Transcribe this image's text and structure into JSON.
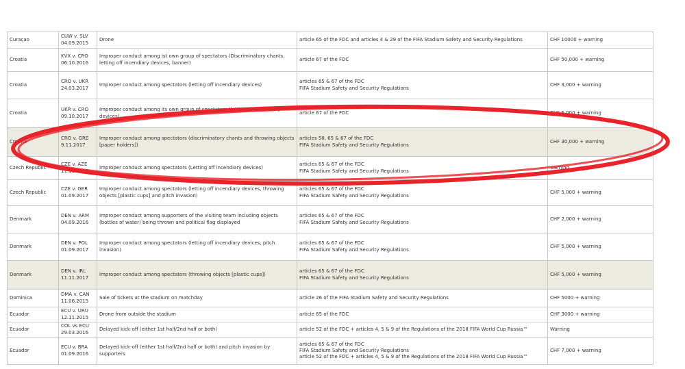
{
  "rows": [
    {
      "country": "Curaçao",
      "match": [
        "CUW v. SLV",
        "04.09.2015"
      ],
      "offence": "Drone",
      "regulations": [
        "article 65 of the FDC and articles 4 & 29 of the FIFA Stadium Safety and Security Regulations"
      ],
      "sanction": "CHF 10000 + warning",
      "height": 24,
      "highlight": false
    },
    {
      "country": "Croatia",
      "match": [
        "KVX v. CRO",
        "06.10.2016"
      ],
      "offence": "Improper conduct among ist own group of spectators (Discriminatory chants, letting off incendiary devices, banner)",
      "regulations": [
        "article 67 of the FDC"
      ],
      "sanction": "CHF 50,000 + warning",
      "height": 34,
      "highlight": false
    },
    {
      "country": "Croatia",
      "match": [
        "CRO v. UKR",
        "24.03.2017"
      ],
      "offence": "Improper conduct among spectators (letting off incendiary devices)",
      "regulations": [
        "articles 65 & 67 of the FDC",
        "FIFA Stadium Safety and Security Regulations"
      ],
      "sanction": "CHF 3,000 + warning",
      "height": 40,
      "highlight": false
    },
    {
      "country": "Croatia",
      "match": [
        "UKR v. CRO",
        "09.10.2017"
      ],
      "offence": "Improper conduct among its own group of spectators (letting off incendiary devices)",
      "regulations": [
        "article 67 of the FDC"
      ],
      "sanction": "CHF 5,000 + warning",
      "height": 42,
      "highlight": false
    },
    {
      "country": "Croatia",
      "match": [
        "CRO v. GRE",
        "9.11.2017"
      ],
      "offence": "Improper conduct among spectators (discriminatory chants and throwing objects [paper holders])",
      "regulations": [
        "articles 58, 65 & 67 of the FDC",
        "FIFA Stadium Safety and Security Regulations"
      ],
      "sanction": "CHF 30,000 + warning",
      "height": 42,
      "highlight": true
    },
    {
      "country": "Czech Republic",
      "match": [
        "CZE v. AZE",
        "11.11.2017"
      ],
      "offence": "Improper conduct among spectators (Letting off incendiary devices)",
      "regulations": [
        "articles 65 & 67 of the FDC",
        "FIFA Stadium Safety and Security Regulations"
      ],
      "sanction": "warning",
      "height": 34,
      "highlight": false
    },
    {
      "country": "Czech Republic",
      "match": [
        "CZE v. GER",
        "01.09.2017"
      ],
      "offence": "Improper conduct among spectators (letting off incendiary devices, throwing objects [plastic cups] and pitch invasion)",
      "regulations": [
        "articles 65 & 67 of the FDC",
        "FIFA Stadium Safety and Security Regulations"
      ],
      "sanction": "CHF 5,000 + warning",
      "height": 38,
      "highlight": false
    },
    {
      "country": "Denmark",
      "match": [
        "DEN v. ARM",
        "04.09.2016"
      ],
      "offence": "Improper conduct among supporters of the visiting team including objects (bottles of water) being thrown and political flag displayed",
      "regulations": [
        "articles 65 & 67 of the FDC",
        "FIFA Stadium Safety and Security Regulations"
      ],
      "sanction": "CHF 2,000 + warning",
      "height": 40,
      "highlight": false
    },
    {
      "country": "Denmark",
      "match": [
        "DEN v. POL",
        "01.09.2017"
      ],
      "offence": "Improper conduct among spectators (letting off incendiary devices, pitch invasion)",
      "regulations": [
        "articles 65 & 67 of the FDC",
        "FIFA Stadium Safety and Security Regulations"
      ],
      "sanction": "CHF 5,000 + warning",
      "height": 40,
      "highlight": false
    },
    {
      "country": "Denmark",
      "match": [
        "DEN v. IRL",
        "11.11.2017"
      ],
      "offence": "Improper conduct among spectators (throwing objects [plastic cups])",
      "regulations": [
        "articles 65 & 67 of the FDC",
        "FIFA Stadium Safety and Security Regulations"
      ],
      "sanction": "CHF 5,000 + warning",
      "height": 42,
      "highlight": true
    },
    {
      "country": "Dominica",
      "match": [
        "DMA v. CAN",
        "11.06.2015"
      ],
      "offence": "Sale of tickets at the stadium on matchday",
      "regulations": [
        "article 26 of the FIFA Stadium Safety and Security Regulations"
      ],
      "sanction": "CHF 5000 + warning",
      "height": 26,
      "highlight": false
    },
    {
      "country": "Ecuador",
      "match": [
        "ECU v. URU",
        "12.11.2015"
      ],
      "offence": "Drone from outside the stadium",
      "regulations": [
        "article 65 of the FDC"
      ],
      "sanction": "CHF 3000 + warning",
      "height": 22,
      "highlight": false
    },
    {
      "country": "Ecuador",
      "match": [
        "COL vs ECU",
        "29.03.2016"
      ],
      "offence": "Delayed kick-off (either 1st half/2nd half or both)",
      "regulations": [
        "article 52 of the FDC + articles 4, 5 & 9 of the Regulations of the 2018 FIFA World Cup Russia™"
      ],
      "sanction": "Warning",
      "height": 22,
      "highlight": false
    },
    {
      "country": "Ecuador",
      "match": [
        "ECU v. BRA",
        "01.09.2016"
      ],
      "offence": "Delayed kick-off (either 1st half/2nd half or both) and pitch invasion by supporters",
      "regulations": [
        "articles 65 & 67 of the FDC",
        "FIFA Stadium Safety and Security Regulations",
        "article 52 of the FDC + articles 4, 5 & 9 of the Regulations of the 2018 FIFA World Cup Russia™"
      ],
      "sanction": "CHF 7,000 + warning",
      "height": 40,
      "highlight": false
    }
  ],
  "annotation": {
    "stroke_color": "#e8232a"
  },
  "colors": {
    "highlight_row": "#ecebe1",
    "border": "#c8c8c8",
    "text": "#333333"
  }
}
